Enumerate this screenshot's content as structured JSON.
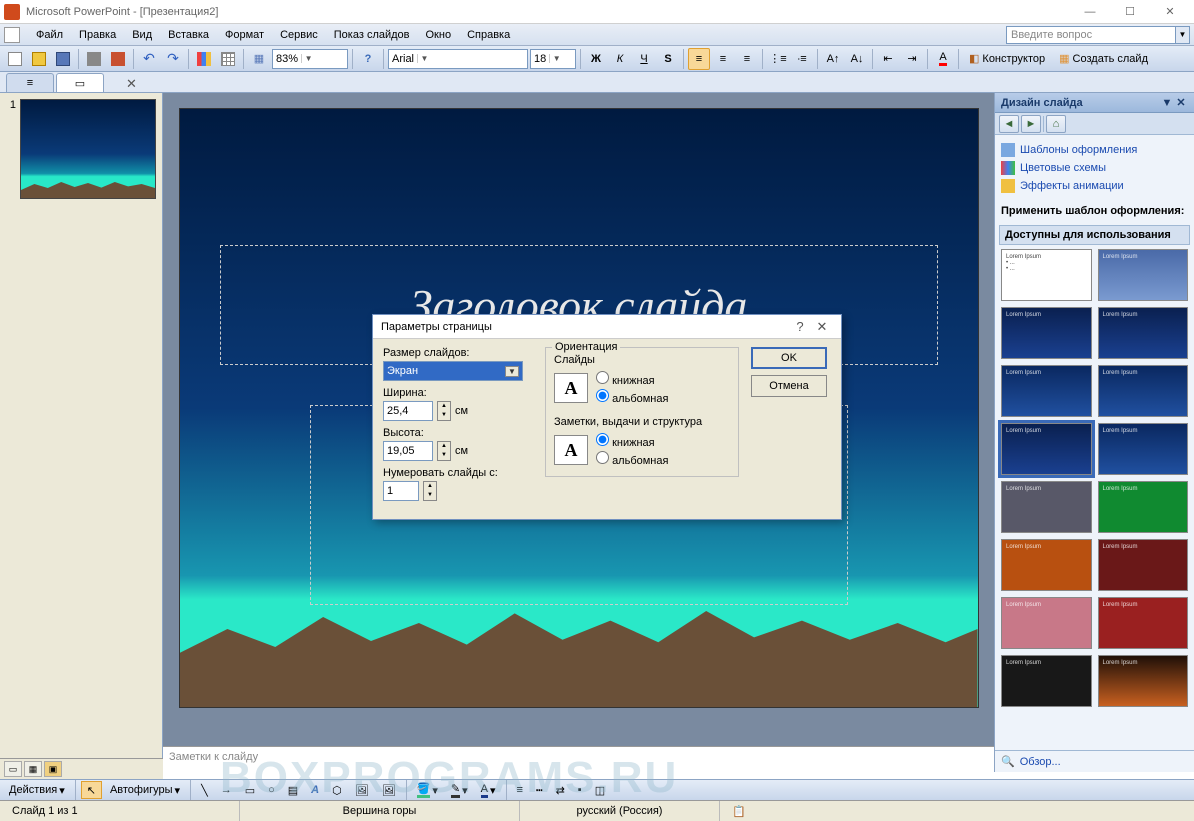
{
  "app": {
    "title": "Microsoft PowerPoint - [Презентация2]"
  },
  "menu": {
    "file": "Файл",
    "edit": "Правка",
    "view": "Вид",
    "insert": "Вставка",
    "format": "Формат",
    "tools": "Сервис",
    "slideshow": "Показ слайдов",
    "window": "Окно",
    "help": "Справка"
  },
  "helpbox": {
    "placeholder": "Введите вопрос"
  },
  "toolbar": {
    "zoom": "83%",
    "font": "Arial",
    "size": "18",
    "designer": "Конструктор",
    "newslide": "Создать слайд"
  },
  "slidepanel": {
    "num": "1"
  },
  "slide": {
    "title": "Заголовок слайда"
  },
  "notes": {
    "placeholder": "Заметки к слайду"
  },
  "taskpane": {
    "title": "Дизайн слайда",
    "links": {
      "templates": "Шаблоны оформления",
      "colors": "Цветовые схемы",
      "effects": "Эффекты анимации"
    },
    "apply_label": "Применить шаблон оформления:",
    "group1": "Доступны для использования",
    "footer": "Обзор..."
  },
  "dialog": {
    "title": "Параметры страницы",
    "size_label": "Размер слайдов:",
    "size_value": "Экран",
    "width_label": "Ширина:",
    "width_value": "25,4",
    "height_label": "Высота:",
    "height_value": "19,05",
    "number_label": "Нумеровать слайды с:",
    "number_value": "1",
    "unit": "см",
    "orientation": "Ориентация",
    "slides": "Слайды",
    "portrait": "книжная",
    "landscape": "альбомная",
    "notes_group": "Заметки, выдачи и структура",
    "ok": "OK",
    "cancel": "Отмена"
  },
  "drawbar": {
    "actions": "Действия",
    "autoshapes": "Автофигуры"
  },
  "status": {
    "slide": "Слайд 1 из 1",
    "template": "Вершина горы",
    "lang": "русский (Россия)"
  },
  "watermark": "BOXPROGRAMS.RU"
}
